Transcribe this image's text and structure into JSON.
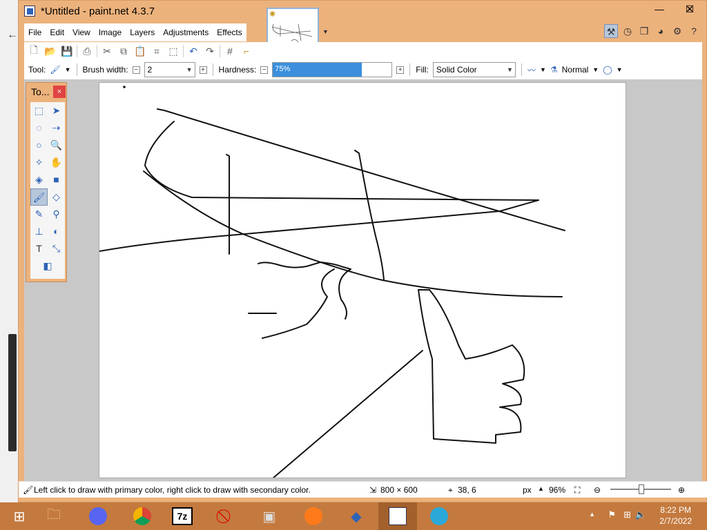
{
  "window": {
    "title": "*Untitled - paint.net 4.3.7"
  },
  "menu": [
    "File",
    "Edit",
    "View",
    "Image",
    "Layers",
    "Adjustments",
    "Effects"
  ],
  "toolbar": {
    "tool_label": "Tool:",
    "brush_width_label": "Brush width:",
    "brush_width_value": "2",
    "hardness_label": "Hardness:",
    "hardness_value": "75%",
    "hardness_fraction": 0.75,
    "fill_label": "Fill:",
    "fill_value": "Solid Color",
    "blend_mode": "Normal"
  },
  "tools_window": {
    "title": "To...",
    "close_glyph": "×"
  },
  "status": {
    "hint": "Left click to draw with primary color, right click to draw with secondary color.",
    "image_size": "800 × 600",
    "cursor_pos": "38, 6",
    "units": "px",
    "zoom": "96%"
  },
  "taskbar": {
    "time": "8:22 PM",
    "date": "2/7/2022",
    "items": [
      "windows-start",
      "file-explorer",
      "discord",
      "chrome",
      "7zip",
      "blocked-app",
      "media-app",
      "firefox",
      "app-droplet",
      "paintnet",
      "edge"
    ]
  },
  "colors": {
    "window_frame": "#ecb27c",
    "taskbar": "#c47a3e",
    "accent": "#3b8fdd"
  }
}
